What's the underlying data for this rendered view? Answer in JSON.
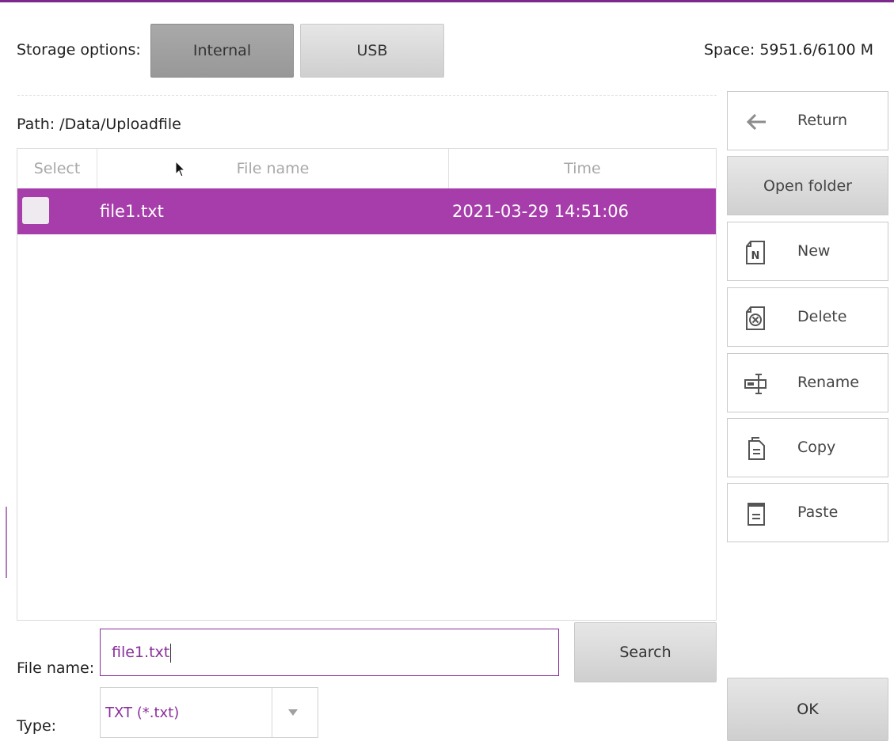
{
  "storage": {
    "label": "Storage options:",
    "internal_label": "Internal",
    "usb_label": "USB",
    "space_text": "Space: 5951.6/6100 M"
  },
  "path": {
    "text": "Path:  /Data/Uploadfile"
  },
  "table": {
    "columns": [
      "Select",
      "File name",
      "Time"
    ],
    "rows": [
      {
        "name": "file1.txt",
        "time": "2021-03-29  14:51:06",
        "selected": true
      }
    ]
  },
  "sidebar": {
    "return_label": "Return",
    "open_folder_label": "Open folder",
    "new_label": "New",
    "delete_label": "Delete",
    "rename_label": "Rename",
    "copy_label": "Copy",
    "paste_label": "Paste",
    "ok_label": "OK"
  },
  "footer": {
    "file_name_label": "File name:",
    "file_name_value": "file1.txt",
    "search_label": "Search",
    "type_label": "Type:",
    "type_value": "TXT (*.txt)"
  },
  "colors": {
    "accent": "#a73cab",
    "frame": "#7b2a8c"
  },
  "icons": {
    "return": "left-arrow-icon",
    "new": "new-document-icon",
    "delete": "delete-document-icon",
    "rename": "rename-icon",
    "copy": "copy-icon",
    "paste": "paste-icon",
    "dropdown": "dropdown-arrow-icon"
  }
}
